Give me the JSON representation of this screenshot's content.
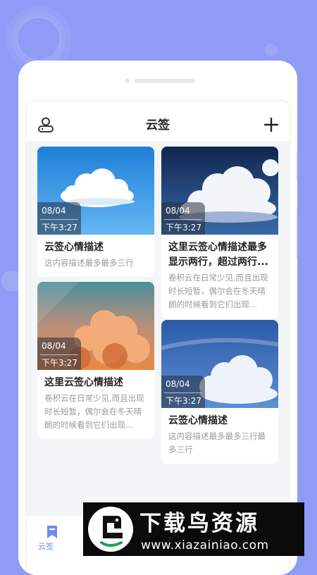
{
  "app": {
    "title": "云签"
  },
  "cards": [
    {
      "date": "08/04",
      "time": "下午3:27",
      "title": "云签心情描述",
      "desc": "这内容描述最多最多三行"
    },
    {
      "date": "08/04",
      "time": "下午3:27",
      "title": "这里云签心情描述",
      "desc": "卷积云在日常少见,而且出现时长短暂，偶尔会在冬天晴朗的时候看到它们出现..."
    },
    {
      "date": "08/04",
      "time": "下午3:27",
      "title": "这里云签心情描述最多显示两行，超过两行...",
      "desc": "卷积云在日常少见,而且出现时长短暂，偶尔会在冬天晴朗的时候看到它们出现..."
    },
    {
      "date": "08/04",
      "time": "下午3:27",
      "title": "云签心情描述",
      "desc": "这内容描述最多最多三行最多三行"
    }
  ],
  "tabbar": {
    "items": [
      {
        "label": "云签",
        "icon": "bookmark-icon",
        "active": true
      }
    ]
  },
  "watermark": {
    "cn": "下载鸟资源",
    "url": "www.xiazainiao.com"
  },
  "colors": {
    "background": "#8f9cf6",
    "accent": "#6f8cf3"
  }
}
